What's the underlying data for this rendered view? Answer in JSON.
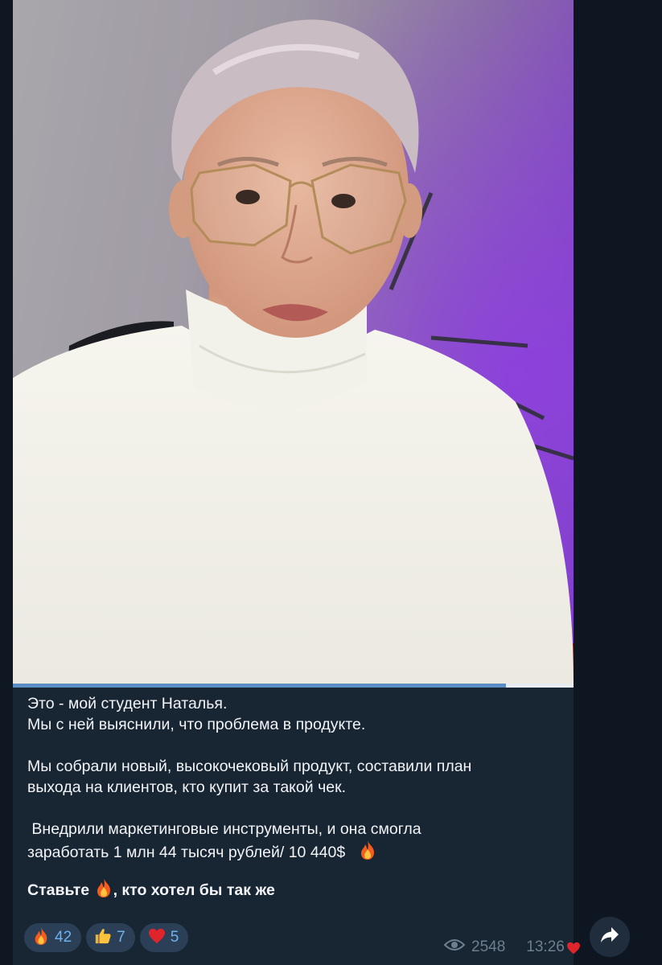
{
  "video": {
    "progress_fraction": 0.88
  },
  "caption": {
    "line1": "Это - мой студент Наталья.",
    "line2": "Мы с ней выяснили, что проблема в продукте.",
    "line3": "Мы собрали новый, высокочековый продукт, составили план",
    "line4": "выхода на клиентов, кто купит за такой чек.",
    "line5": " Внедрили маркетинговые инструменты, и она смогла",
    "line6": "заработать 1 млн 44 тысяч рублей/ 10 440$",
    "cta_before": "Ставьте",
    "cta_after": ", кто хотел бы так же"
  },
  "reactions": [
    {
      "icon": "fire-icon",
      "count": "42"
    },
    {
      "icon": "thumbs-up-icon",
      "count": "7"
    },
    {
      "icon": "heart-icon",
      "count": "5"
    }
  ],
  "meta": {
    "views": "2548",
    "time": "13:26"
  },
  "colors": {
    "background": "#0e1621",
    "bubble": "#182533",
    "reaction_bg": "#2b4056",
    "reaction_count": "#6cb2f2",
    "meta_text": "#6d7f8f",
    "progress_fill": "#5b8ec7"
  }
}
